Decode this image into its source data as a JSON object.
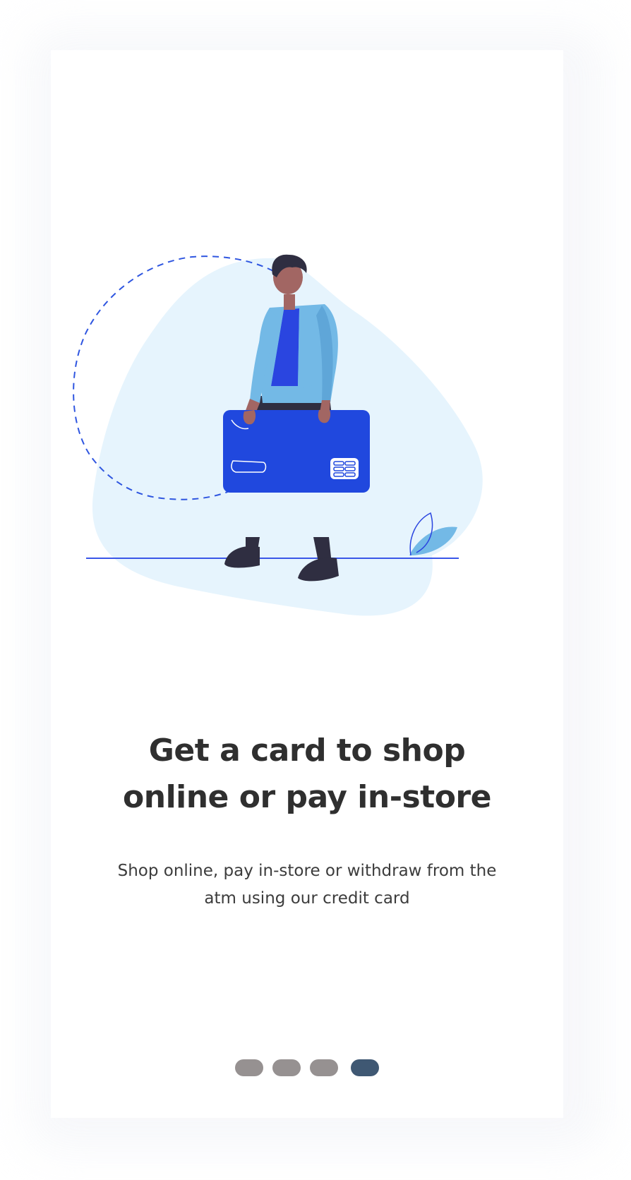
{
  "onboarding": {
    "headline_line1": "Get a card to shop",
    "headline_line2": "online or pay in-store",
    "subtitle_line1": "Shop online, pay in-store or withdraw from the",
    "subtitle_line2": "atm using our credit card"
  },
  "pager": {
    "total_pages": 4,
    "current_page": 4
  },
  "colors": {
    "blob": "#e6f4fd",
    "card": "#2048de",
    "jacket": "#73b9e6",
    "shirt": "#2a45e0",
    "skin": "#a26663",
    "hair": "#2f2e41",
    "ground_line": "#3a56e8",
    "dot_inactive": "#969191",
    "dot_active": "#3f5873",
    "headline": "#2f2f2f"
  }
}
